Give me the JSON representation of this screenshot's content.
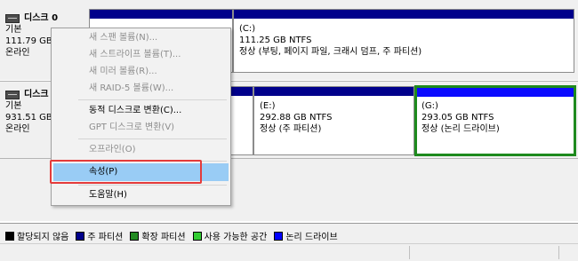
{
  "disks": [
    {
      "name": "디스크 0",
      "type": "기본",
      "size": "111.79 GB",
      "status": "온라인",
      "partitions": [
        {
          "label": "",
          "size_fs": "",
          "status": ""
        },
        {
          "label": "(C:)",
          "size_fs": "111.25 GB NTFS",
          "status": "정상 (부팅, 페이지 파일, 크래시 덤프, 주 파티션)"
        }
      ]
    },
    {
      "name": "디스크 1",
      "type": "기본",
      "size": "931.51 GB",
      "status": "온라인",
      "partitions": [
        {
          "label": "",
          "size_fs": "",
          "status": ""
        },
        {
          "label": "(E:)",
          "size_fs": "292.88 GB NTFS",
          "status": "정상 (주 파티션)"
        },
        {
          "label": "(G:)",
          "size_fs": "293.05 GB NTFS",
          "status": "정상 (논리 드라이브)",
          "selected": true
        }
      ]
    }
  ],
  "context_menu": {
    "items": [
      {
        "label": "새 스팬 볼륨(N)...",
        "enabled": false
      },
      {
        "label": "새 스트라이프 볼륨(T)...",
        "enabled": false
      },
      {
        "label": "새 미러 볼륨(R)...",
        "enabled": false
      },
      {
        "label": "새 RAID-5 볼륨(W)...",
        "enabled": false
      },
      {
        "label": "동적 디스크로 변환(C)...",
        "enabled": true
      },
      {
        "label": "GPT 디스크로 변환(V)",
        "enabled": false
      },
      {
        "label": "오프라인(O)",
        "enabled": false
      },
      {
        "label": "속성(P)",
        "enabled": true,
        "highlighted": true
      },
      {
        "label": "도움말(H)",
        "enabled": true
      }
    ]
  },
  "legend": [
    {
      "label": "할당되지 않음",
      "color": "#000000"
    },
    {
      "label": "주 파티션",
      "color": "#00008b"
    },
    {
      "label": "확장 파티션",
      "color": "#228b22"
    },
    {
      "label": "사용 가능한 공간",
      "color": "#32cd32"
    },
    {
      "label": "논리 드라이브",
      "color": "#0000ff"
    }
  ],
  "colors": {
    "primary_partition": "#00008b",
    "logical_drive": "#0a0aff",
    "selection_border": "#1e8a1e",
    "menu_highlight": "#99ccf5",
    "annotation_box": "#e43b3b"
  }
}
